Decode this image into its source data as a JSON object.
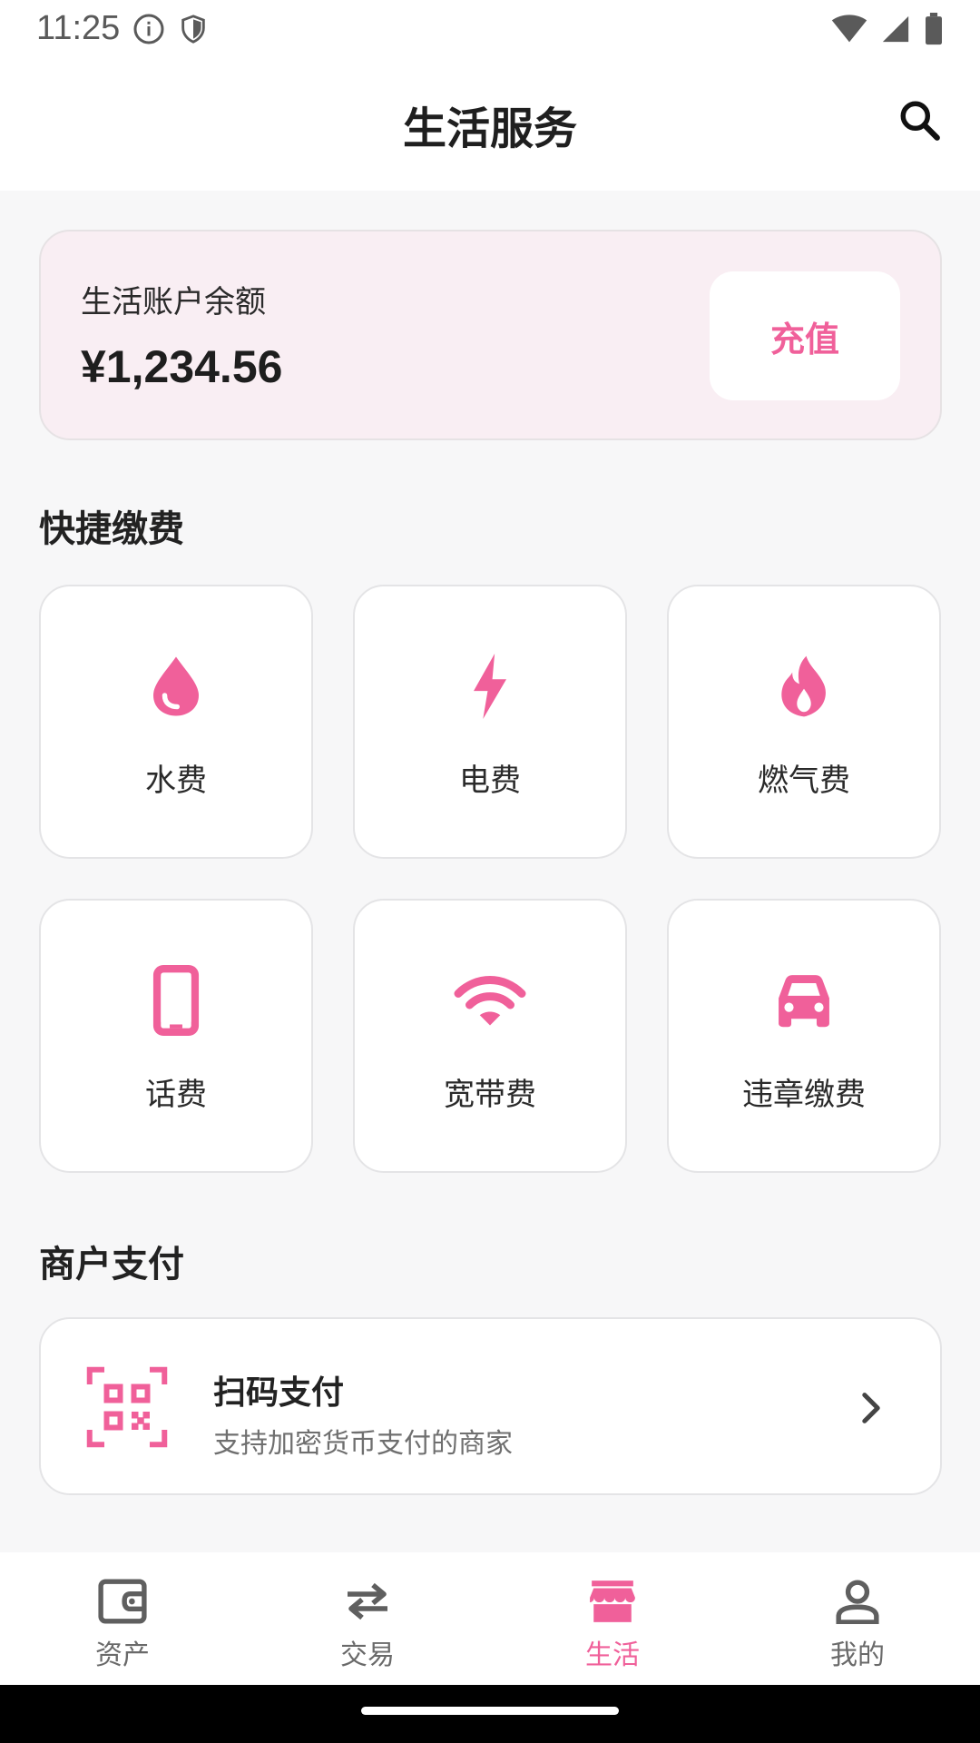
{
  "status_bar": {
    "time": "11:25"
  },
  "header": {
    "title": "生活服务"
  },
  "balance": {
    "label": "生活账户余额",
    "amount": "¥1,234.56",
    "recharge_label": "充值"
  },
  "quick_pay": {
    "title": "快捷缴费",
    "items": [
      {
        "label": "水费",
        "icon": "water-drop-icon"
      },
      {
        "label": "电费",
        "icon": "lightning-icon"
      },
      {
        "label": "燃气费",
        "icon": "flame-icon"
      },
      {
        "label": "话费",
        "icon": "phone-icon"
      },
      {
        "label": "宽带费",
        "icon": "wifi-icon"
      },
      {
        "label": "违章缴费",
        "icon": "car-icon"
      }
    ]
  },
  "merchant": {
    "title": "商户支付",
    "item": {
      "title": "扫码支付",
      "subtitle": "支持加密货币支付的商家",
      "icon": "qr-code-icon"
    }
  },
  "bottom_nav": {
    "items": [
      {
        "label": "资产",
        "icon": "wallet-icon"
      },
      {
        "label": "交易",
        "icon": "swap-icon"
      },
      {
        "label": "生活",
        "icon": "store-icon",
        "active": true
      },
      {
        "label": "我的",
        "icon": "person-icon"
      }
    ]
  },
  "colors": {
    "accent": "#f0609a",
    "card_tint": "#f9eef3",
    "background": "#f7f7f8"
  }
}
